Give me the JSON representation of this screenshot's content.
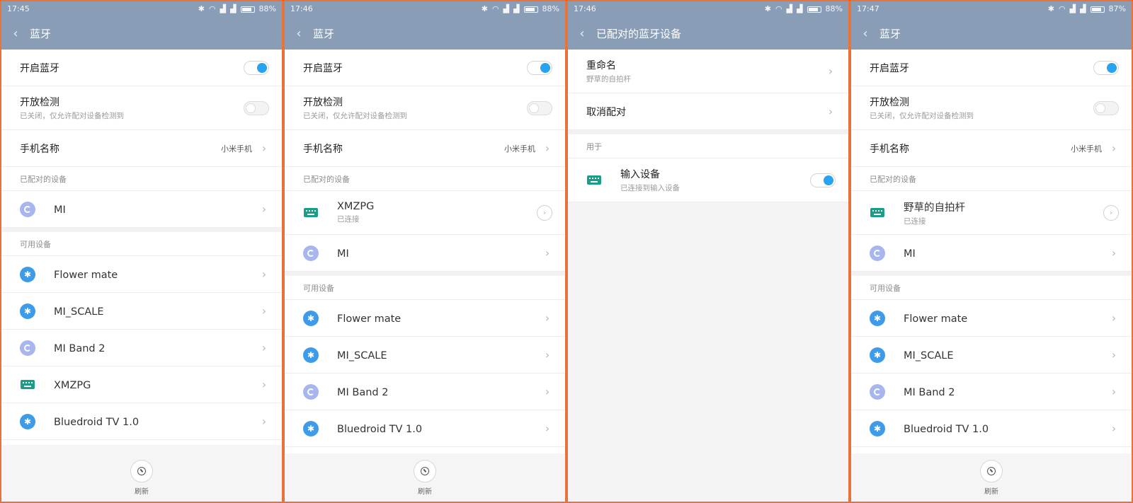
{
  "screens": [
    {
      "status": {
        "time": "17:45",
        "battery": "88%",
        "battery_level": 0.88
      },
      "title": "蓝牙",
      "settings": {
        "bt_on_label": "开启蓝牙",
        "bt_on_state": true,
        "discover_label": "开放检测",
        "discover_sub": "已关闭，仅允许配对设备检测到",
        "discover_state": false,
        "phone_name_label": "手机名称",
        "phone_name_value": "小米手机"
      },
      "paired_header": "已配对的设备",
      "paired": [
        {
          "name": "MI",
          "icon": "band-icon"
        }
      ],
      "available_header": "可用设备",
      "available": [
        {
          "name": "Flower mate",
          "icon": "bluetooth-icon"
        },
        {
          "name": "MI_SCALE",
          "icon": "bluetooth-icon"
        },
        {
          "name": "MI Band 2",
          "icon": "band-icon"
        },
        {
          "name": "XMZPG",
          "icon": "keyboard-icon"
        },
        {
          "name": "Bluedroid TV 1.0",
          "icon": "bluetooth-icon"
        }
      ],
      "refresh_label": "刷新"
    },
    {
      "status": {
        "time": "17:46",
        "battery": "88%",
        "battery_level": 0.88
      },
      "title": "蓝牙",
      "settings": {
        "bt_on_label": "开启蓝牙",
        "bt_on_state": true,
        "discover_label": "开放检测",
        "discover_sub": "已关闭，仅允许配对设备检测到",
        "discover_state": false,
        "phone_name_label": "手机名称",
        "phone_name_value": "小米手机"
      },
      "paired_header": "已配对的设备",
      "paired": [
        {
          "name": "XMZPG",
          "sub": "已连接",
          "icon": "keyboard-icon"
        },
        {
          "name": "MI",
          "icon": "band-icon"
        }
      ],
      "available_header": "可用设备",
      "available": [
        {
          "name": "Flower mate",
          "icon": "bluetooth-icon"
        },
        {
          "name": "MI_SCALE",
          "icon": "bluetooth-icon"
        },
        {
          "name": "MI Band 2",
          "icon": "band-icon"
        },
        {
          "name": "Bluedroid TV 1.0",
          "icon": "bluetooth-icon"
        }
      ],
      "refresh_label": "刷新"
    },
    {
      "status": {
        "time": "17:46",
        "battery": "88%",
        "battery_level": 0.88
      },
      "title": "已配对的蓝牙设备",
      "rename_label": "重命名",
      "rename_value": "野草的自拍杆",
      "unpair_label": "取消配对",
      "used_for_header": "用于",
      "input_device_label": "输入设备",
      "input_device_sub": "已连接到输入设备",
      "input_device_state": true
    },
    {
      "status": {
        "time": "17:47",
        "battery": "87%",
        "battery_level": 0.87
      },
      "title": "蓝牙",
      "settings": {
        "bt_on_label": "开启蓝牙",
        "bt_on_state": true,
        "discover_label": "开放检测",
        "discover_sub": "已关闭，仅允许配对设备检测到",
        "discover_state": false,
        "phone_name_label": "手机名称",
        "phone_name_value": "小米手机"
      },
      "paired_header": "已配对的设备",
      "paired": [
        {
          "name": "野草的自拍杆",
          "sub": "已连接",
          "icon": "keyboard-icon"
        },
        {
          "name": "MI",
          "icon": "band-icon"
        }
      ],
      "available_header": "可用设备",
      "available": [
        {
          "name": "Flower mate",
          "icon": "bluetooth-icon"
        },
        {
          "name": "MI_SCALE",
          "icon": "bluetooth-icon"
        },
        {
          "name": "MI Band 2",
          "icon": "band-icon"
        },
        {
          "name": "Bluedroid TV 1.0",
          "icon": "bluetooth-icon"
        }
      ],
      "refresh_label": "刷新"
    }
  ],
  "colors": {
    "header_bg": "#8a9db6",
    "toggle_on": "#29a3ee",
    "bluetooth": "#3d9be9",
    "band": "#a8b5ef",
    "keyboard": "#1a9e8a",
    "frame": "#e8733a"
  }
}
